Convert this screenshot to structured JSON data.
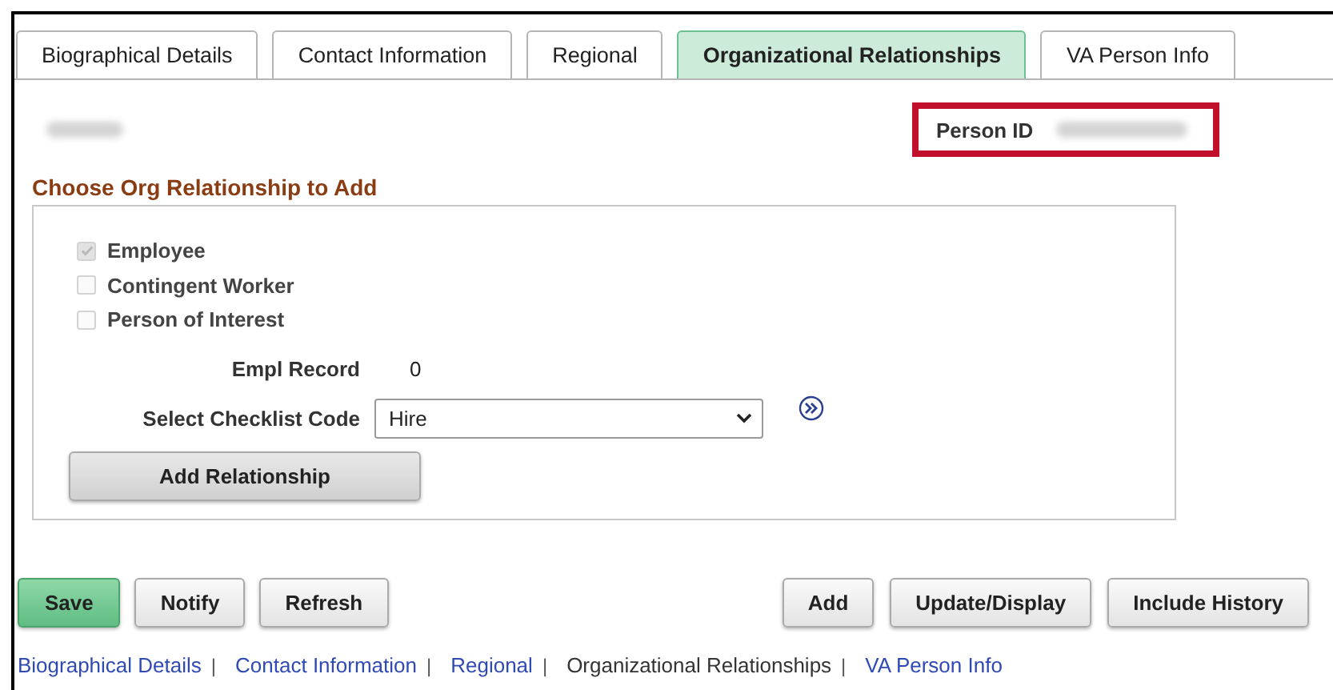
{
  "tabs": [
    {
      "label": "Biographical Details",
      "selected": false
    },
    {
      "label": "Contact Information",
      "selected": false
    },
    {
      "label": "Regional",
      "selected": false
    },
    {
      "label": "Organizational Relationships",
      "selected": true
    },
    {
      "label": "VA Person Info",
      "selected": false
    }
  ],
  "person_id": {
    "label": "Person ID",
    "highlighted": true
  },
  "section_title": "Choose Org Relationship to Add",
  "relationships": [
    {
      "label": "Employee",
      "checked": true
    },
    {
      "label": "Contingent Worker",
      "checked": false
    },
    {
      "label": "Person of Interest",
      "checked": false
    }
  ],
  "empl_record": {
    "label": "Empl Record",
    "value": "0"
  },
  "checklist": {
    "label": "Select Checklist Code",
    "value": "Hire"
  },
  "add_relationship_button": "Add Relationship",
  "left_buttons": [
    {
      "label": "Save",
      "kind": "primary"
    },
    {
      "label": "Notify",
      "kind": "normal"
    },
    {
      "label": "Refresh",
      "kind": "normal"
    }
  ],
  "right_buttons": [
    "Add",
    "Update/Display",
    "Include History"
  ],
  "footer_links": [
    {
      "label": "Biographical Details",
      "selected": false
    },
    {
      "label": "Contact Information",
      "selected": false
    },
    {
      "label": "Regional",
      "selected": false
    },
    {
      "label": "Organizational Relationships",
      "selected": true
    },
    {
      "label": "VA Person Info",
      "selected": false
    }
  ],
  "separator": "|"
}
